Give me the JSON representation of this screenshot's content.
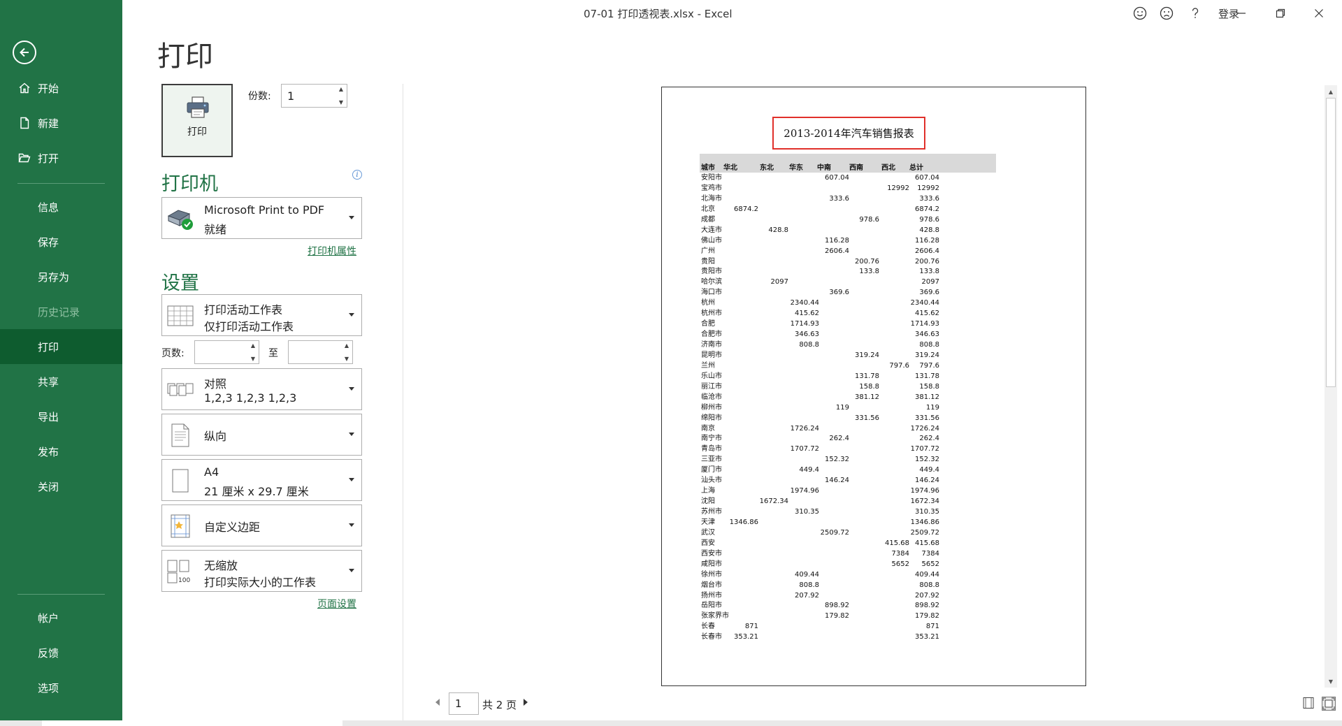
{
  "window": {
    "title": "07-01 打印透视表.xlsx  -  Excel",
    "login": "登录"
  },
  "nav": {
    "items": [
      {
        "label": "开始"
      },
      {
        "label": "新建"
      },
      {
        "label": "打开"
      },
      {
        "label": "信息"
      },
      {
        "label": "保存"
      },
      {
        "label": "另存为"
      },
      {
        "label": "历史记录"
      },
      {
        "label": "打印"
      },
      {
        "label": "共享"
      },
      {
        "label": "导出"
      },
      {
        "label": "发布"
      },
      {
        "label": "关闭"
      },
      {
        "label": "帐户"
      },
      {
        "label": "反馈"
      },
      {
        "label": "选项"
      }
    ]
  },
  "print": {
    "title": "打印",
    "button_label": "打印",
    "copies_label": "份数:",
    "copies_value": "1",
    "printer_section": "打印机",
    "printer_name": "Microsoft Print to PDF",
    "printer_status": "就绪",
    "printer_props_link": "打印机属性",
    "settings_section": "设置",
    "scope_l1": "打印活动工作表",
    "scope_l2": "仅打印活动工作表",
    "pages_label": "页数:",
    "to_label": "至",
    "collate_l1": "对照",
    "collate_l2": "1,2,3     1,2,3     1,2,3",
    "orientation": "纵向",
    "paper_l1": "A4",
    "paper_l2": "21 厘米 x 29.7 厘米",
    "margins": "自定义边距",
    "scaling_l1": "无缩放",
    "scaling_l2": "打印实际大小的工作表",
    "page_setup_link": "页面设置"
  },
  "pager": {
    "current": "1",
    "total": "共 2 页"
  },
  "sheet": {
    "title": "2013-2014年汽车销售报表",
    "headers": [
      "城市",
      "华北",
      "东北",
      "华东",
      "中南",
      "西南",
      "西北",
      "总计"
    ],
    "rows": [
      [
        "安阳市",
        "",
        "",
        "",
        "607.04",
        "",
        "",
        "607.04"
      ],
      [
        "宝鸡市",
        "",
        "",
        "",
        "",
        "",
        "12992",
        "12992"
      ],
      [
        "北海市",
        "",
        "",
        "",
        "333.6",
        "",
        "",
        "333.6"
      ],
      [
        "北京",
        "6874.2",
        "",
        "",
        "",
        "",
        "",
        "6874.2"
      ],
      [
        "成都",
        "",
        "",
        "",
        "",
        "978.6",
        "",
        "978.6"
      ],
      [
        "大连市",
        "",
        "428.8",
        "",
        "",
        "",
        "",
        "428.8"
      ],
      [
        "佛山市",
        "",
        "",
        "",
        "116.28",
        "",
        "",
        "116.28"
      ],
      [
        "广州",
        "",
        "",
        "",
        "2606.4",
        "",
        "",
        "2606.4"
      ],
      [
        "贵阳",
        "",
        "",
        "",
        "",
        "200.76",
        "",
        "200.76"
      ],
      [
        "贵阳市",
        "",
        "",
        "",
        "",
        "133.8",
        "",
        "133.8"
      ],
      [
        "哈尔滨",
        "",
        "2097",
        "",
        "",
        "",
        "",
        "2097"
      ],
      [
        "海口市",
        "",
        "",
        "",
        "369.6",
        "",
        "",
        "369.6"
      ],
      [
        "杭州",
        "",
        "",
        "2340.44",
        "",
        "",
        "",
        "2340.44"
      ],
      [
        "杭州市",
        "",
        "",
        "415.62",
        "",
        "",
        "",
        "415.62"
      ],
      [
        "合肥",
        "",
        "",
        "1714.93",
        "",
        "",
        "",
        "1714.93"
      ],
      [
        "合肥市",
        "",
        "",
        "346.63",
        "",
        "",
        "",
        "346.63"
      ],
      [
        "济南市",
        "",
        "",
        "808.8",
        "",
        "",
        "",
        "808.8"
      ],
      [
        "昆明市",
        "",
        "",
        "",
        "",
        "319.24",
        "",
        "319.24"
      ],
      [
        "兰州",
        "",
        "",
        "",
        "",
        "",
        "797.6",
        "797.6"
      ],
      [
        "乐山市",
        "",
        "",
        "",
        "",
        "131.78",
        "",
        "131.78"
      ],
      [
        "丽江市",
        "",
        "",
        "",
        "",
        "158.8",
        "",
        "158.8"
      ],
      [
        "临沧市",
        "",
        "",
        "",
        "",
        "381.12",
        "",
        "381.12"
      ],
      [
        "柳州市",
        "",
        "",
        "",
        "119",
        "",
        "",
        "119"
      ],
      [
        "绵阳市",
        "",
        "",
        "",
        "",
        "331.56",
        "",
        "331.56"
      ],
      [
        "南京",
        "",
        "",
        "1726.24",
        "",
        "",
        "",
        "1726.24"
      ],
      [
        "南宁市",
        "",
        "",
        "",
        "262.4",
        "",
        "",
        "262.4"
      ],
      [
        "青岛市",
        "",
        "",
        "1707.72",
        "",
        "",
        "",
        "1707.72"
      ],
      [
        "三亚市",
        "",
        "",
        "",
        "152.32",
        "",
        "",
        "152.32"
      ],
      [
        "厦门市",
        "",
        "",
        "449.4",
        "",
        "",
        "",
        "449.4"
      ],
      [
        "汕头市",
        "",
        "",
        "",
        "146.24",
        "",
        "",
        "146.24"
      ],
      [
        "上海",
        "",
        "",
        "1974.96",
        "",
        "",
        "",
        "1974.96"
      ],
      [
        "沈阳",
        "",
        "1672.34",
        "",
        "",
        "",
        "",
        "1672.34"
      ],
      [
        "苏州市",
        "",
        "",
        "310.35",
        "",
        "",
        "",
        "310.35"
      ],
      [
        "天津",
        "1346.86",
        "",
        "",
        "",
        "",
        "",
        "1346.86"
      ],
      [
        "武汉",
        "",
        "",
        "",
        "2509.72",
        "",
        "",
        "2509.72"
      ],
      [
        "西安",
        "",
        "",
        "",
        "",
        "",
        "415.68",
        "415.68"
      ],
      [
        "西安市",
        "",
        "",
        "",
        "",
        "",
        "7384",
        "7384"
      ],
      [
        "咸阳市",
        "",
        "",
        "",
        "",
        "",
        "5652",
        "5652"
      ],
      [
        "徐州市",
        "",
        "",
        "409.44",
        "",
        "",
        "",
        "409.44"
      ],
      [
        "烟台市",
        "",
        "",
        "808.8",
        "",
        "",
        "",
        "808.8"
      ],
      [
        "扬州市",
        "",
        "",
        "207.92",
        "",
        "",
        "",
        "207.92"
      ],
      [
        "岳阳市",
        "",
        "",
        "",
        "898.92",
        "",
        "",
        "898.92"
      ],
      [
        "张家界市",
        "",
        "",
        "",
        "179.82",
        "",
        "",
        "179.82"
      ],
      [
        "长春",
        "871",
        "",
        "",
        "",
        "",
        "",
        "871"
      ],
      [
        "长春市",
        "353.21",
        "",
        "",
        "",
        "",
        "",
        "353.21"
      ]
    ]
  }
}
